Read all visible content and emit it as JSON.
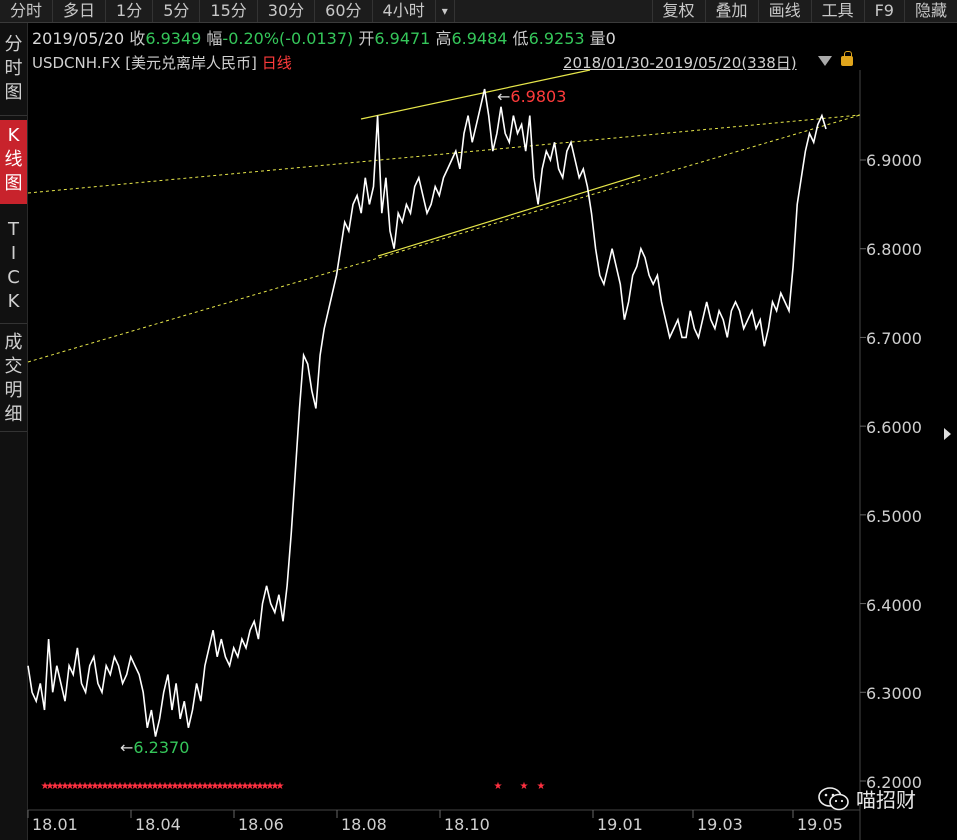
{
  "toolbar": {
    "tabs": [
      "分时",
      "多日",
      "1分",
      "5分",
      "15分",
      "30分",
      "60分",
      "4小时"
    ],
    "more": "▾",
    "right": [
      "复权",
      "叠加",
      "画线",
      "工具",
      "F9",
      "隐藏"
    ]
  },
  "side_tabs": {
    "fenshi": [
      "分",
      "时",
      "图"
    ],
    "kline": [
      "K",
      "线",
      "图"
    ],
    "tick": [
      "T",
      "I",
      "C",
      "K"
    ],
    "detail": [
      "成",
      "交",
      "明",
      "细"
    ]
  },
  "info": {
    "date": "2019/05/20",
    "close_label": "收",
    "close": "6.9349",
    "amp_label": "幅",
    "amp": "-0.20%(-0.0137)",
    "open_label": "开",
    "open": "6.9471",
    "high_label": "高",
    "high": "6.9484",
    "low_label": "低",
    "low": "6.9253",
    "vol_label": "量",
    "vol": "0"
  },
  "symbol": "USDCNH.FX [美元兑离岸人民币]",
  "period": "日线",
  "range": "2018/01/30-2019/05/20(338日)",
  "watermark": "喵招财",
  "colors": {
    "line": "#ffffff",
    "trend": "#e6e64a",
    "up": "#35c65a",
    "down": "#ff3b3b",
    "marker": "#ff3040"
  },
  "chart_data": {
    "type": "line",
    "x_ticks": [
      "18.01",
      "18.04",
      "18.06",
      "18.08",
      "18.10",
      "19.01",
      "19.03",
      "19.05"
    ],
    "y_ticks": [
      "6.9000",
      "6.8000",
      "6.7000",
      "6.6000",
      "6.5000",
      "6.4000",
      "6.3000",
      "6.2000"
    ],
    "ylim": [
      6.19,
      7.0
    ],
    "annotations": {
      "high": "6.9803",
      "low": "6.2370"
    },
    "series": [
      {
        "values": [
          6.33,
          6.3,
          6.29,
          6.31,
          6.28,
          6.36,
          6.3,
          6.33,
          6.31,
          6.29,
          6.33,
          6.32,
          6.35,
          6.31,
          6.3,
          6.33,
          6.34,
          6.31,
          6.3,
          6.33,
          6.32,
          6.34,
          6.33,
          6.31,
          6.32,
          6.34,
          6.33,
          6.32,
          6.3,
          6.26,
          6.28,
          6.25,
          6.27,
          6.3,
          6.32,
          6.28,
          6.31,
          6.27,
          6.29,
          6.26,
          6.28,
          6.31,
          6.29,
          6.33,
          6.35,
          6.37,
          6.34,
          6.36,
          6.34,
          6.33,
          6.35,
          6.34,
          6.36,
          6.35,
          6.37,
          6.38,
          6.36,
          6.4,
          6.42,
          6.4,
          6.39,
          6.41,
          6.38,
          6.42,
          6.48,
          6.55,
          6.62,
          6.68,
          6.67,
          6.64,
          6.62,
          6.68,
          6.71,
          6.73,
          6.75,
          6.77,
          6.8,
          6.83,
          6.82,
          6.85,
          6.86,
          6.84,
          6.88,
          6.85,
          6.87,
          6.95,
          6.84,
          6.88,
          6.82,
          6.8,
          6.84,
          6.83,
          6.85,
          6.84,
          6.87,
          6.88,
          6.86,
          6.84,
          6.85,
          6.87,
          6.86,
          6.88,
          6.89,
          6.9,
          6.91,
          6.89,
          6.93,
          6.95,
          6.92,
          6.94,
          6.96,
          6.98,
          6.95,
          6.91,
          6.93,
          6.96,
          6.93,
          6.92,
          6.95,
          6.93,
          6.94,
          6.91,
          6.95,
          6.88,
          6.85,
          6.89,
          6.91,
          6.9,
          6.92,
          6.89,
          6.88,
          6.91,
          6.92,
          6.9,
          6.88,
          6.89,
          6.87,
          6.84,
          6.8,
          6.77,
          6.76,
          6.78,
          6.8,
          6.78,
          6.76,
          6.72,
          6.74,
          6.77,
          6.78,
          6.8,
          6.79,
          6.77,
          6.76,
          6.77,
          6.74,
          6.72,
          6.7,
          6.71,
          6.72,
          6.7,
          6.7,
          6.73,
          6.71,
          6.7,
          6.72,
          6.74,
          6.72,
          6.71,
          6.73,
          6.72,
          6.7,
          6.73,
          6.74,
          6.73,
          6.71,
          6.72,
          6.73,
          6.71,
          6.72,
          6.69,
          6.71,
          6.74,
          6.73,
          6.75,
          6.74,
          6.73,
          6.78,
          6.85,
          6.88,
          6.91,
          6.93,
          6.92,
          6.94,
          6.95,
          6.935
        ]
      }
    ]
  }
}
